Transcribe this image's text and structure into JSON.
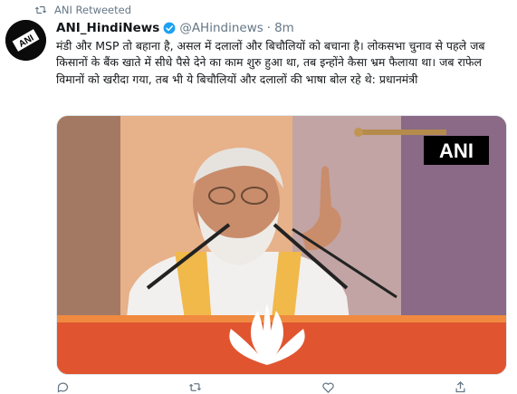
{
  "retweet": {
    "text": "ANI Retweeted",
    "icon": "retweet-icon"
  },
  "tweet": {
    "display_name": "ANI_HindiNews",
    "handle": "@AHindinews",
    "separator": "·",
    "time": "8m",
    "verified_icon": "verified-badge-icon",
    "text": "मंडी और MSP तो बहाना है, असल में दलालों और बिचौलियों को बचाना है। लोकसभा चुनाव से पहले जब किसानों के बैंक खाते में सीधे पैसे देने का काम शुरु हुआ था, तब इन्होंने कैसा भ्रम फैलाया था। जब राफेल विमानों को खरीदा गया, तब भी ये बिचौलियों और दलालों की भाषा बोल रहे थे: प्रधानमंत्री",
    "avatar_logo": "ANI",
    "media": {
      "watermark": "ANI"
    }
  },
  "actions": [
    {
      "name": "reply",
      "icon": "reply-icon",
      "count": ""
    },
    {
      "name": "retweet",
      "icon": "retweet-icon",
      "count": ""
    },
    {
      "name": "like",
      "icon": "like-icon",
      "count": ""
    },
    {
      "name": "share",
      "icon": "share-icon",
      "count": ""
    }
  ],
  "colors": {
    "secondary_text": "#657786",
    "verified_blue": "#1da1f2",
    "saffron": "#f2a65a"
  }
}
